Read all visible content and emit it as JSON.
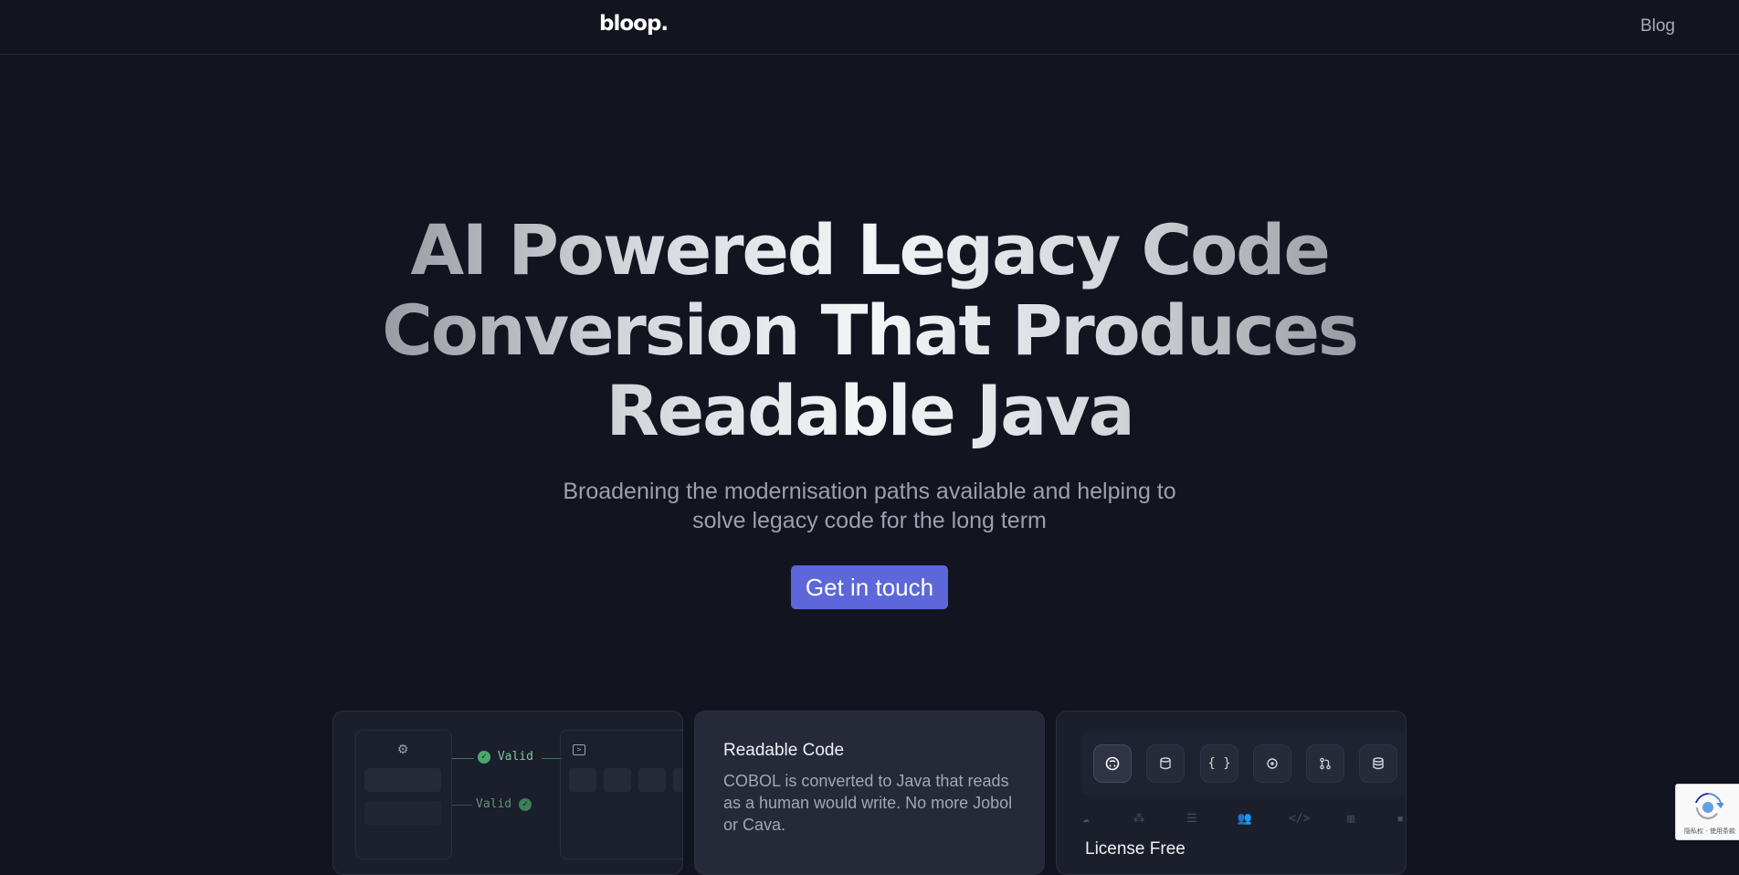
{
  "header": {
    "logo": "bloop.",
    "nav": {
      "blog": "Blog"
    }
  },
  "hero": {
    "title": "AI Powered Legacy Code Conversion That Produces Readable Java",
    "subtitle": "Broadening the modernisation paths available and helping to solve legacy code for the long term",
    "cta": "Get in touch"
  },
  "cards": [
    {
      "diagram": {
        "valid_top": "Valid",
        "valid_bottom": "Valid"
      }
    },
    {
      "title": "Readable Code",
      "description": "COBOL is converted to Java that reads as a human would write. No more Jobol or Cava."
    },
    {
      "icons": [
        "github-icon",
        "database-icon",
        "braces-icon",
        "target-icon",
        "git-pull-request-icon",
        "database-stack-icon"
      ],
      "faded_icons": [
        "cloud-icon",
        "cluster-icon",
        "list-icon",
        "users-icon",
        "code-icon",
        "book-icon",
        "more-icon"
      ],
      "title": "License Free"
    }
  ],
  "recaptcha": {
    "text": "隐私权 - 使用条款"
  },
  "colors": {
    "background": "#121420",
    "cta": "#5d67d9",
    "valid_green": "#7fc79a"
  }
}
